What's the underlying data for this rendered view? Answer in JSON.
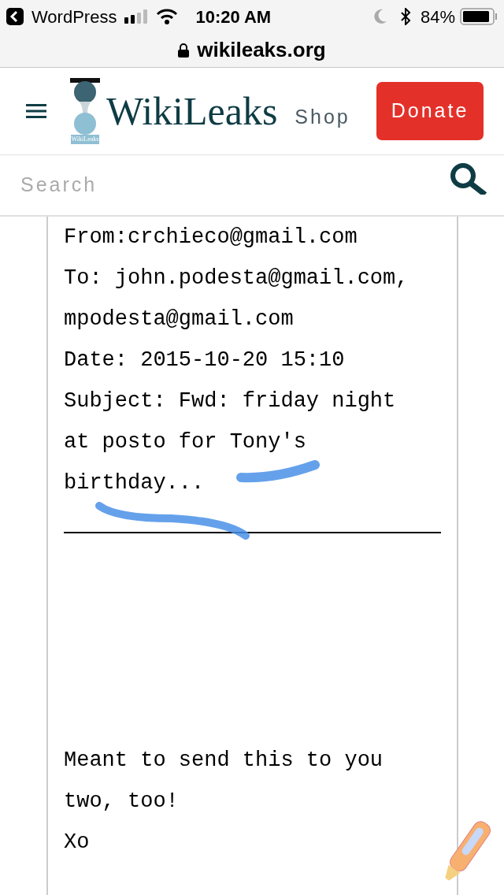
{
  "status_bar": {
    "back_app": "WordPress",
    "time": "10:20 AM",
    "battery": "84%"
  },
  "address_bar": {
    "url": "wikileaks.org"
  },
  "header": {
    "logo_caption": "WikiLeaks",
    "site_name": "WikiLeaks",
    "links": [
      "Shop"
    ],
    "donate": "Donate"
  },
  "search": {
    "placeholder": "Search"
  },
  "email": {
    "header_lines": [
      "From:crchieco@gmail.com",
      "To: john.podesta@gmail.com,",
      "mpodesta@gmail.com",
      "Date: 2015-10-20 15:10",
      "Subject: Fwd: friday night",
      "at posto for Tony's",
      "birthday..."
    ],
    "body_lines": [
      "Meant to send this to you",
      "two, too!",
      "Xo"
    ]
  }
}
